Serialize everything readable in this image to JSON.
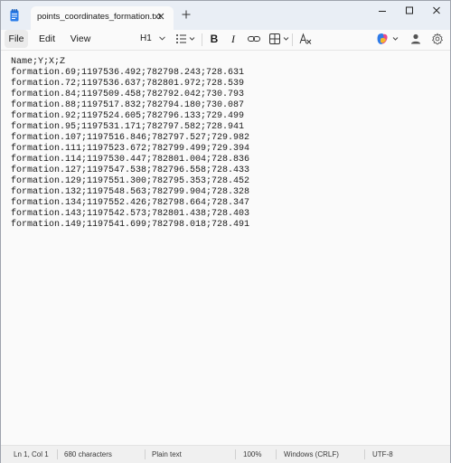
{
  "titlebar": {
    "tab_title": "points_coordinates_formation.txt"
  },
  "menu": {
    "file": "File",
    "edit": "Edit",
    "view": "View"
  },
  "toolbar": {
    "heading_label": "H1"
  },
  "document": {
    "lines": [
      "Name;Y;X;Z",
      "formation.69;1197536.492;782798.243;728.631",
      "formation.72;1197536.637;782801.972;728.539",
      "formation.84;1197509.458;782792.042;730.793",
      "formation.88;1197517.832;782794.180;730.087",
      "formation.92;1197524.605;782796.133;729.499",
      "formation.95;1197531.171;782797.582;728.941",
      "formation.107;1197516.846;782797.527;729.982",
      "formation.111;1197523.672;782799.499;729.394",
      "formation.114;1197530.447;782801.004;728.836",
      "formation.127;1197547.538;782796.558;728.433",
      "formation.129;1197551.300;782795.353;728.452",
      "formation.132;1197548.563;782799.904;728.328",
      "formation.134;1197552.426;782798.664;728.347",
      "formation.143;1197542.573;782801.438;728.403",
      "formation.149;1197541.699;782798.018;728.491"
    ]
  },
  "status": {
    "cursor": "Ln 1, Col 1",
    "char_count": "680 characters",
    "format": "Plain text",
    "zoom": "100%",
    "line_ending": "Windows (CRLF)",
    "encoding": "UTF-8"
  },
  "colors": {
    "titlebar_bg": "#e9eef5",
    "editor_bg": "#fafafa",
    "accent_blue": "#1e6fd9"
  }
}
